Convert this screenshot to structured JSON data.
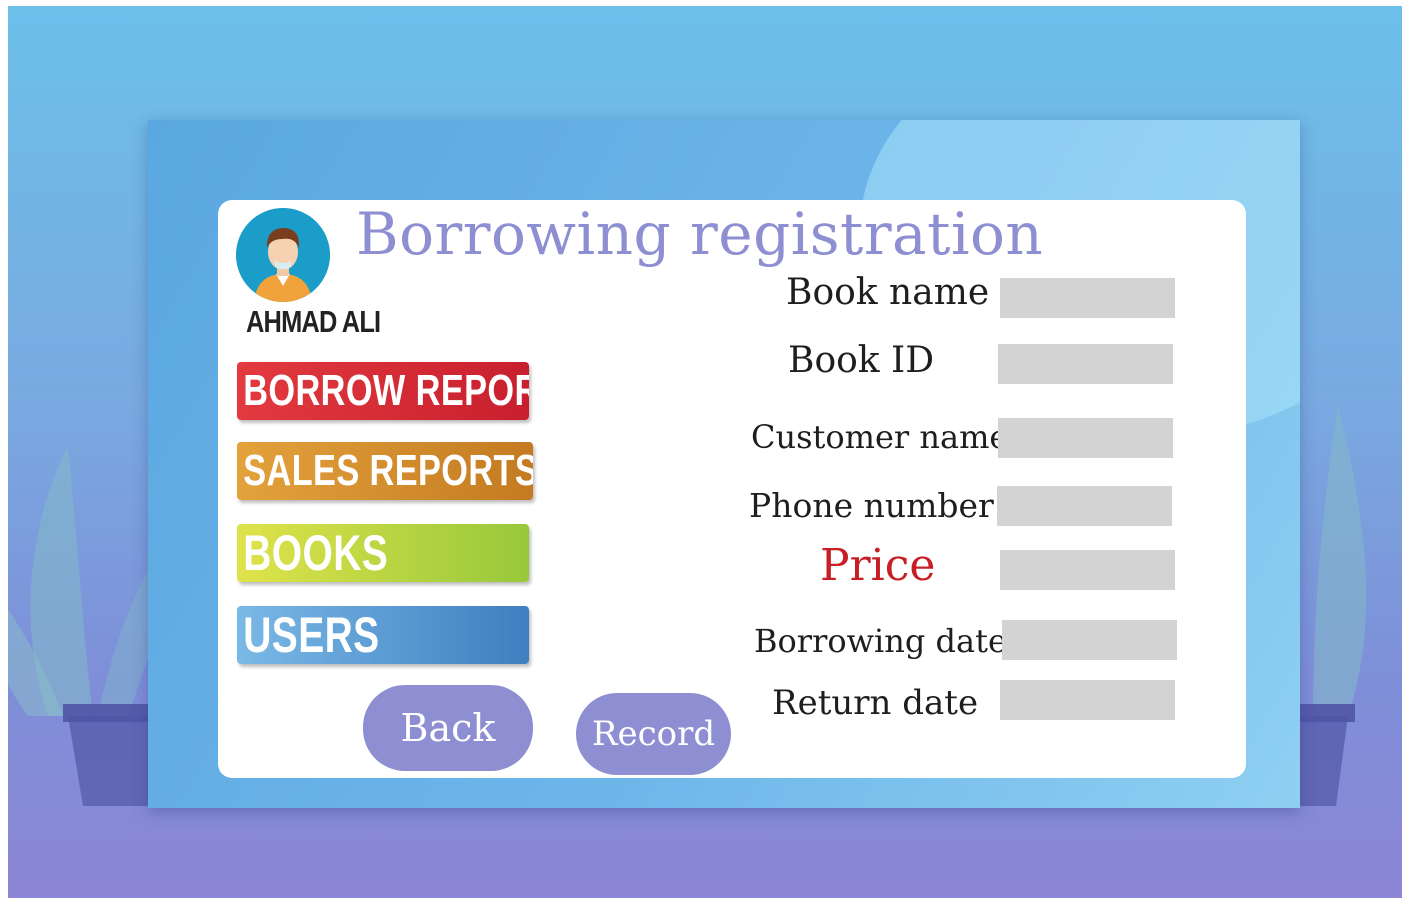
{
  "page": {
    "title": "Borrowing registration",
    "user": {
      "name": "AHMAD ALI"
    }
  },
  "menu": {
    "borrow_reports": "BORROW REPORTS",
    "sales_reports": "SALES REPORTS",
    "books": "BOOKS",
    "users": "USERS"
  },
  "actions": {
    "back": "Back",
    "record": "Record"
  },
  "form": {
    "book_name": {
      "label": "Book name",
      "value": ""
    },
    "book_id": {
      "label": "Book ID",
      "value": ""
    },
    "customer_name": {
      "label": "Customer name",
      "value": ""
    },
    "phone_number": {
      "label": "Phone number",
      "value": ""
    },
    "price": {
      "label": "Price",
      "value": ""
    },
    "borrowing_date": {
      "label": "Borrowing date",
      "value": ""
    },
    "return_date": {
      "label": "Return date",
      "value": ""
    }
  },
  "colors": {
    "accent": "#8e8fd2",
    "price_label": "#c81e25",
    "field_fill": "#d3d3d3",
    "borrow_reports": "#d42a36",
    "sales_reports": "#d48e2e",
    "books": "#bcd744",
    "users": "#5c9ad3"
  },
  "icons": {
    "avatar": "user-avatar-icon"
  }
}
